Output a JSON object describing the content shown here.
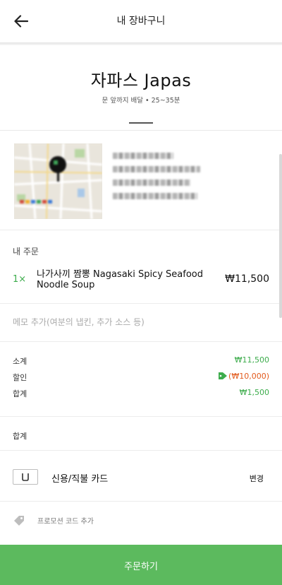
{
  "header": {
    "title": "내 장바구니"
  },
  "store": {
    "name": "자파스 Japas",
    "delivery_info": "문 앞까지 배달 • 25~35분"
  },
  "order": {
    "title": "내 주문",
    "items": [
      {
        "quantity": "1×",
        "name": "나가사끼 짬뽕 Nagasaki Spicy Seafood Noodle Soup",
        "price": "₩11,500"
      }
    ]
  },
  "memo": {
    "placeholder": "메모 추가(여분의 냅킨, 추가 소스 등)",
    "value": ""
  },
  "summary": {
    "subtotal_label": "소계",
    "subtotal_value": "₩11,500",
    "discount_label": "할인",
    "discount_value": "(₩10,000)",
    "total_row_label": "합계",
    "total_row_value": "₩1,500"
  },
  "total": {
    "label": "합계"
  },
  "payment": {
    "method_label": "신용/직불 카드",
    "change_label": "변경"
  },
  "promo": {
    "label": "프로모션 코드 추가"
  },
  "cta": {
    "label": "주문하기"
  },
  "colors": {
    "accent_green": "#5cba5e",
    "price_green": "#3dac4c",
    "discount_red": "#e25a1c"
  },
  "icons": [
    "back-arrow-icon",
    "map-pin-icon",
    "price-tag-icon",
    "card-icon",
    "promo-tag-icon"
  ]
}
